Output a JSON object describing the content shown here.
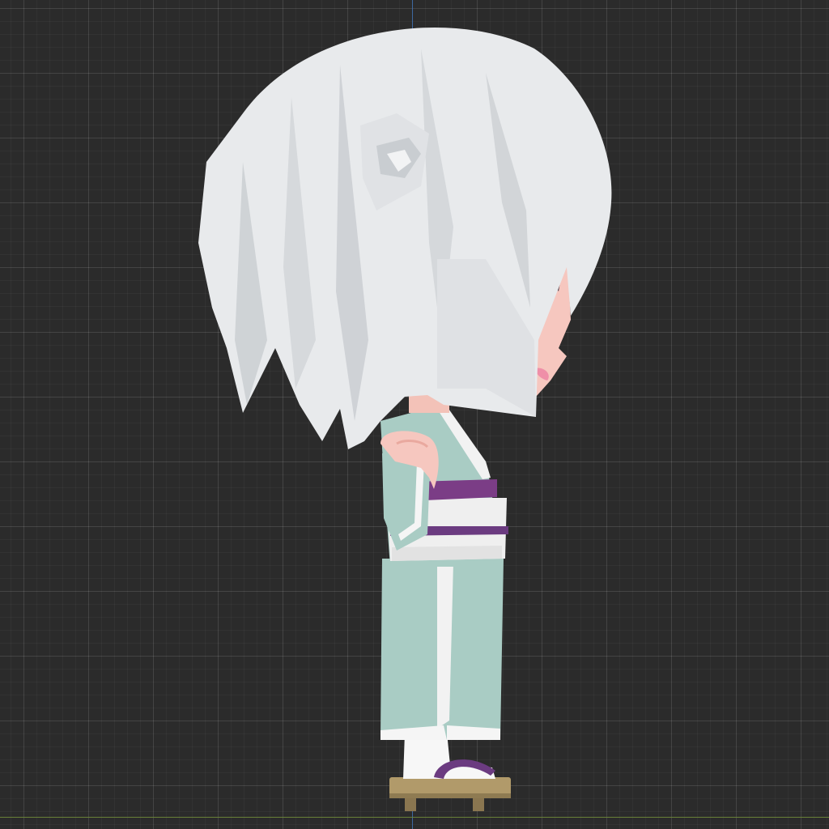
{
  "viewport": {
    "view": "side-orthographic",
    "grid": true,
    "background_color": "#2b2b2b",
    "grid_color": "#3a3a3a",
    "axis_vertical_color": "#3d6fb0",
    "axis_horizontal_color": "#6f8a3a"
  },
  "character": {
    "type": "chibi-3d-model",
    "hair_color": "#e8eaec",
    "robe_color": "#a9ccc4",
    "sash_color": "#efefef",
    "sash_stripe_color": "#7b3d86",
    "skin_color": "#f6c7bf",
    "geta_color": "#b19a6a",
    "strap_color": "#6b3b80"
  }
}
